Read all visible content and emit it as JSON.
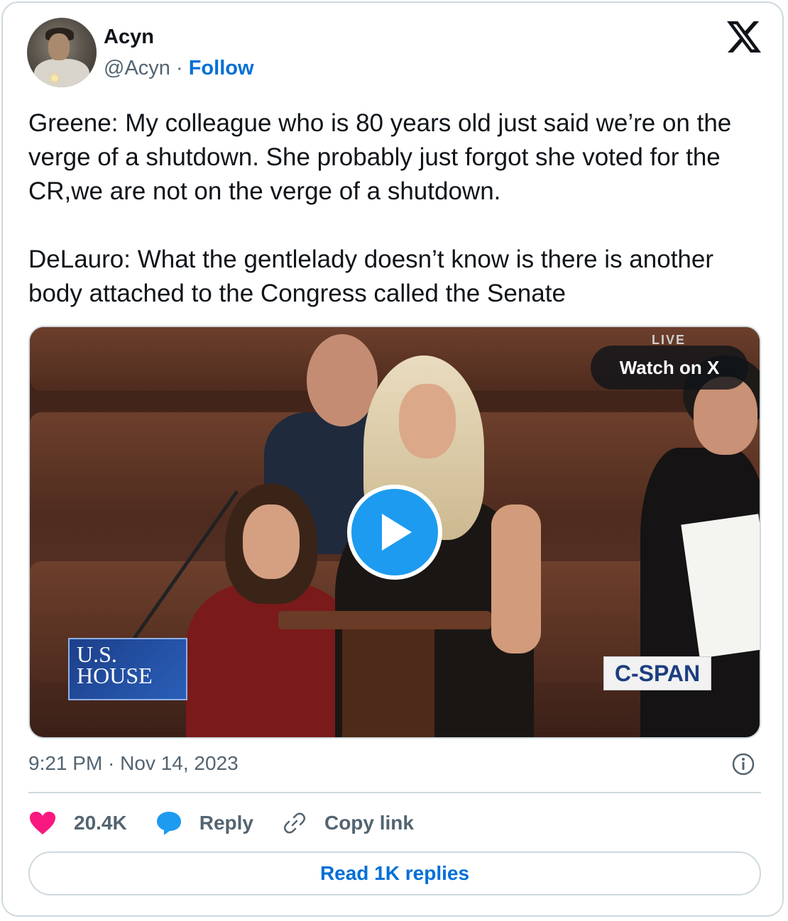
{
  "author": {
    "name": "Acyn",
    "handle": "@Acyn",
    "separator": " · ",
    "follow_label": "Follow",
    "avatar_icon": "avatar-image"
  },
  "brand": {
    "logo_icon": "x-logo-icon"
  },
  "tweet": {
    "paragraphs": [
      "Greene: My colleague who is 80 years old just said we’re on the verge of a shutdown. She probably just forgot she voted for the CR,we are not on the verge of a shutdown.",
      "DeLauro: What the gentlelady doesn’t know is there is another body attached to the Congress called the Senate"
    ]
  },
  "media": {
    "watch_label": "Watch on X",
    "live_text": "LIVE",
    "house_logo_line1": "U.S.",
    "house_logo_line2": "HOUSE",
    "cspan_logo": "C-SPAN",
    "play_icon": "play-icon"
  },
  "meta": {
    "timestamp": "9:21 PM · Nov 14, 2023",
    "info_icon": "info-icon"
  },
  "actions": {
    "like_count": "20.4K",
    "reply_label": "Reply",
    "copy_link_label": "Copy link"
  },
  "read_replies_label": "Read 1K replies",
  "colors": {
    "link_blue": "#006fd6",
    "like_pink": "#f91880",
    "reply_blue": "#1d9bf0",
    "muted_text": "#536471",
    "border": "#cfd9de"
  }
}
